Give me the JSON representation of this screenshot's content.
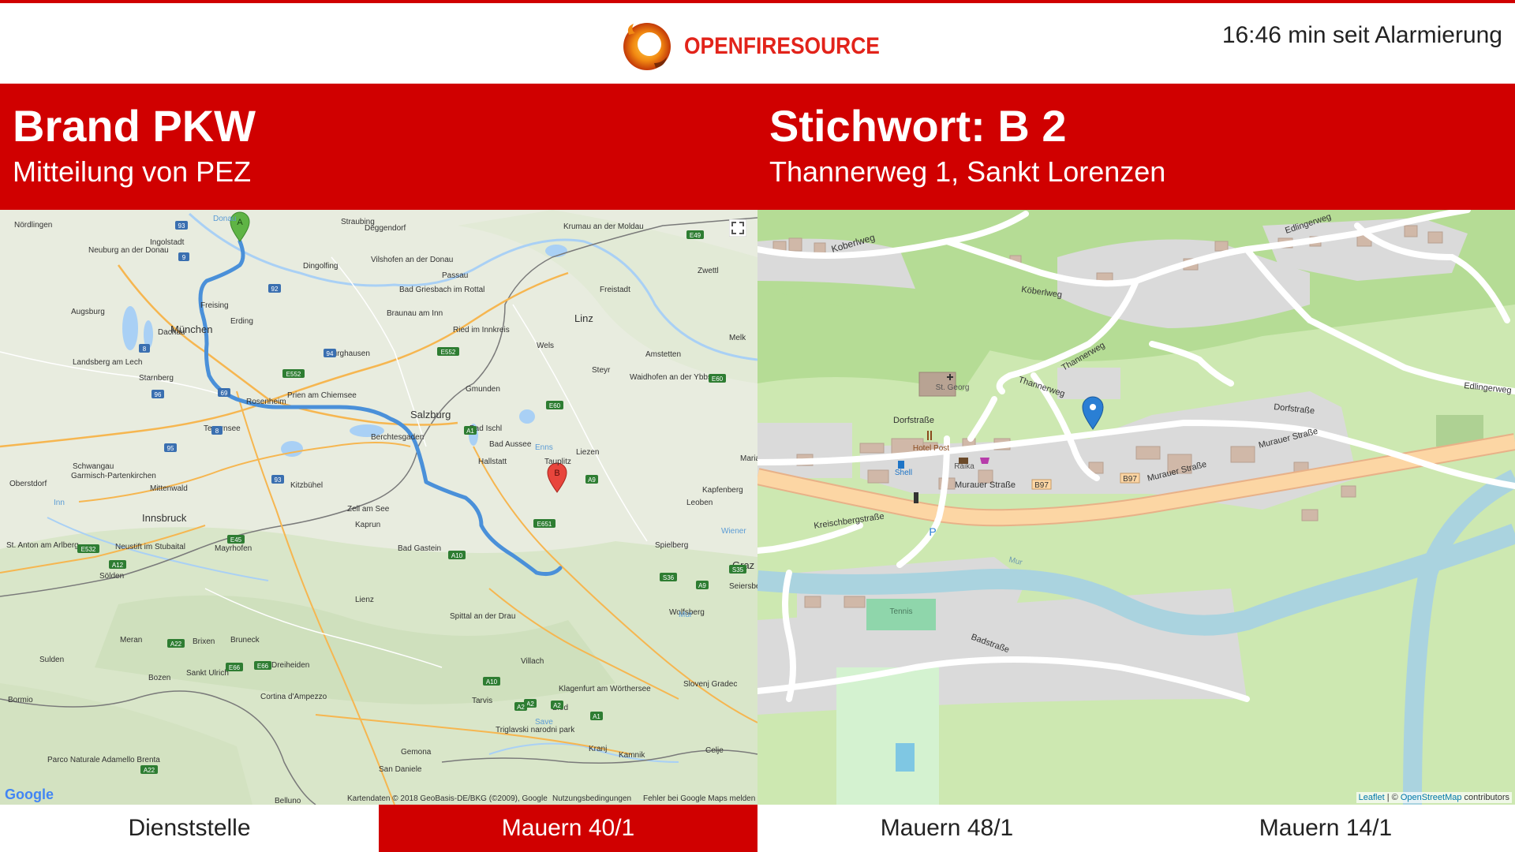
{
  "header": {
    "brand": "OPENFIRESOURCE",
    "timer": "16:46 min seit Alarmierung"
  },
  "alarm": {
    "title": "Brand PKW",
    "subtitle": "Mitteilung von PEZ",
    "keyword": "Stichwort: B 2",
    "address": "Thannerweg 1, Sankt Lorenzen"
  },
  "route_map": {
    "marker_a": "A",
    "marker_b": "B",
    "labels": [
      "Nördlingen",
      "Ingolstadt",
      "Straubing",
      "Deggendorf",
      "Krumau an der Moldau",
      "Neuburg an der Donau",
      "Dingolfing",
      "Vilshofen an der Donau",
      "Passau",
      "Zwettl",
      "Augsburg",
      "Freising",
      "Erding",
      "Bad Griesbach im Rottal",
      "Freistadt",
      "Linz",
      "München",
      "Dachau",
      "Braunau am Inn",
      "Ried im Innkreis",
      "Wels",
      "Amstetten",
      "Melk",
      "Landsberg am Lech",
      "Starnberg",
      "Burghausen",
      "Steyr",
      "Waidhofen an der Ybbs",
      "Rosenheim",
      "Prien am Chiemsee",
      "Gmunden",
      "Salzburg",
      "Bad Ischl",
      "Tegernsee",
      "Berchtesgaden",
      "Mariazell",
      "Garmisch-Partenkirchen",
      "Schwangau",
      "Bad Aussee",
      "Liezen",
      "Kitzbühel",
      "Hallstatt",
      "Tauplitz",
      "Kapfenberg",
      "Oberstdorf",
      "Mittenwald",
      "Leoben",
      "Innsbruck",
      "Zell am See",
      "Kaprun",
      "Spielberg",
      "Mayrhofen",
      "Bad Gastein",
      "Graz",
      "St. Anton am Arlberg",
      "Neustift im Stubaital",
      "Sölden",
      "Seiersberg",
      "Lienz",
      "Wolfsberg",
      "Spittal an der Drau",
      "Meran",
      "Brixen",
      "Bruneck",
      "Villach",
      "Klagenfurt am Wörthersee",
      "Sulden",
      "Bozen",
      "Sankt Ulrich",
      "Dreiheiden",
      "Slovenj Gradec",
      "Bormio",
      "Cortina d'Ampezzo",
      "Tarvis",
      "Bled",
      "Triglavski narodni park",
      "Parco Naturale Adamello Brenta",
      "Gemona",
      "Kranj",
      "Kamnik",
      "Celje",
      "San Daniele",
      "Belluno",
      "Donau",
      "Inn",
      "Save",
      "Mur",
      "Wiener",
      "Enns"
    ],
    "road_shields": [
      "E49",
      "93",
      "9",
      "92",
      "8",
      "94",
      "E552",
      "E552",
      "96",
      "69",
      "8",
      "E60",
      "A1",
      "95",
      "93",
      "E60",
      "A9",
      "E651",
      "A12",
      "E532",
      "E45",
      "A10",
      "A10",
      "A22",
      "E66",
      "S36",
      "S35",
      "A2",
      "A2",
      "A9",
      "A22",
      "A1",
      "A2",
      "E66"
    ],
    "attribution": "Kartendaten © 2018 GeoBasis-DE/BKG (©2009), Google",
    "terms": "Nutzungsbedingungen",
    "report": "Fehler bei Google Maps melden",
    "google_logo": "Google"
  },
  "detail_map": {
    "labels": {
      "koberlweg_1": "Koberlweg",
      "koberlweg_2": "Köberlweg",
      "edlingerweg_1": "Edlingerweg",
      "edlingerweg_2": "Edlingerweg",
      "thannerweg_1": "Thannerweg",
      "thannerweg_2": "Thannerweg",
      "dorfstrasse_1": "Dorfstraße",
      "dorfstrasse_2": "Dorfstraße",
      "st_georg": "St. Georg",
      "hotel_post": "Hotel Post",
      "raika": "Raika",
      "shell": "Shell",
      "murauer_1": "Murauer Straße",
      "murauer_2": "Murauer Straße",
      "murauer_3": "Murauer Straße",
      "b97_1": "B97",
      "b97_2": "B97",
      "kreischberg": "Kreischbergstraße",
      "mur": "Mur",
      "tennis": "Tennis",
      "badstrasse": "Badstraße",
      "parking": "P"
    },
    "attribution_leaflet": "Leaflet",
    "attribution_sep": " | © ",
    "attribution_osm": "OpenStreetMap",
    "attribution_tail": " contributors"
  },
  "tabs": [
    {
      "label": "Dienststelle",
      "active": false
    },
    {
      "label": "Mauern 40/1",
      "active": true
    },
    {
      "label": "Mauern 48/1",
      "active": false
    },
    {
      "label": "Mauern 14/1",
      "active": false
    }
  ],
  "colors": {
    "accent": "#d00000",
    "route": "#4a90d9",
    "marker_a": "#5fb445",
    "marker_b": "#e8453c",
    "marker_detail": "#2a7fd4"
  }
}
